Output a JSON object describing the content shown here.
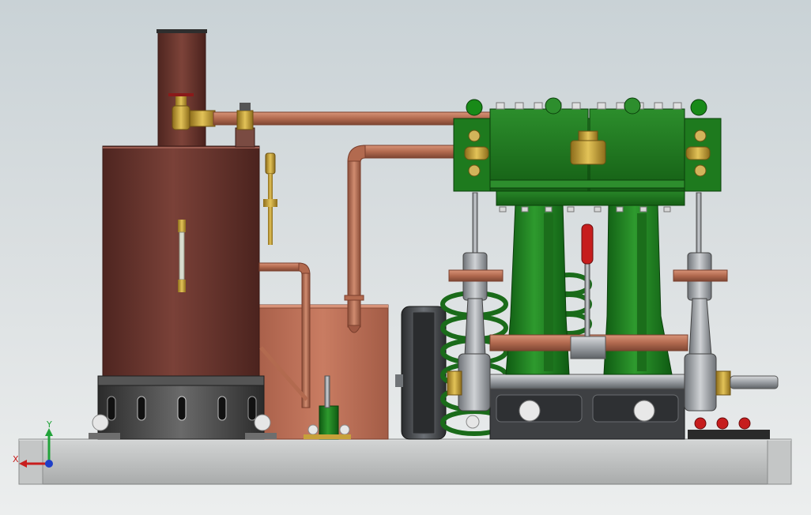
{
  "viewport": {
    "name": "cad-3d-viewport",
    "model": "vertical-boiler-twin-cylinder-steam-engine"
  },
  "colors": {
    "background_top": "#c9d2d6",
    "background_bottom": "#eceeee",
    "copper": "#b26a4f",
    "boiler": "#6e3a32",
    "engine_green": "#1f7a1f",
    "brass": "#c7a13a",
    "steel": "#9a9ea3",
    "base_plate": "#bfc1c1",
    "water_tank": "#c0725a",
    "handle_red": "#c61d1d"
  },
  "triad": {
    "x_label": "X",
    "y_label": "Y",
    "x_color": "#c81e1e",
    "y_color": "#22a33a",
    "z_color": "#1e3fc8"
  }
}
